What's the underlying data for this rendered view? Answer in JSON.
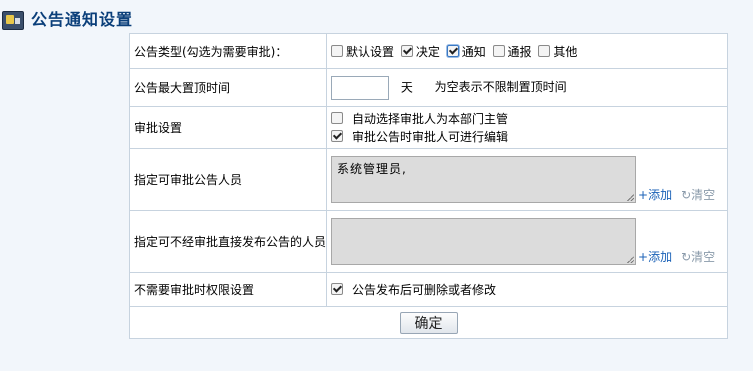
{
  "page": {
    "title": "公告通知设置",
    "submit_label": "确定"
  },
  "rows": {
    "type": {
      "label": "公告类型(勾选为需要审批)：",
      "options": [
        {
          "label": "默认设置",
          "checked": false
        },
        {
          "label": "决定",
          "checked": true
        },
        {
          "label": "通知",
          "checked": true
        },
        {
          "label": "通报",
          "checked": false
        },
        {
          "label": "其他",
          "checked": false
        }
      ]
    },
    "top_time": {
      "label": "公告最大置顶时间",
      "value": "",
      "unit": "天",
      "hint": "为空表示不限制置顶时间"
    },
    "approval": {
      "label": "审批设置",
      "options": [
        {
          "label": "自动选择审批人为本部门主管",
          "checked": false
        },
        {
          "label": "审批公告时审批人可进行编辑",
          "checked": true
        }
      ]
    },
    "approvers": {
      "label": "指定可审批公告人员",
      "value": "系统管理员,",
      "add_label": "添加",
      "clear_label": "清空"
    },
    "direct_publishers": {
      "label": "指定可不经审批直接发布公告的人员",
      "value": "",
      "add_label": "添加",
      "clear_label": "清空"
    },
    "no_time_limit": {
      "label": "不需要审批时权限设置",
      "option": {
        "label": "公告发布后可删除或者修改",
        "checked": true
      }
    }
  },
  "icons": {
    "add": "+",
    "clear": "↻"
  },
  "colors": {
    "title": "#0b3f7a",
    "link": "#1b62b7",
    "background": "#f2f6fb"
  }
}
